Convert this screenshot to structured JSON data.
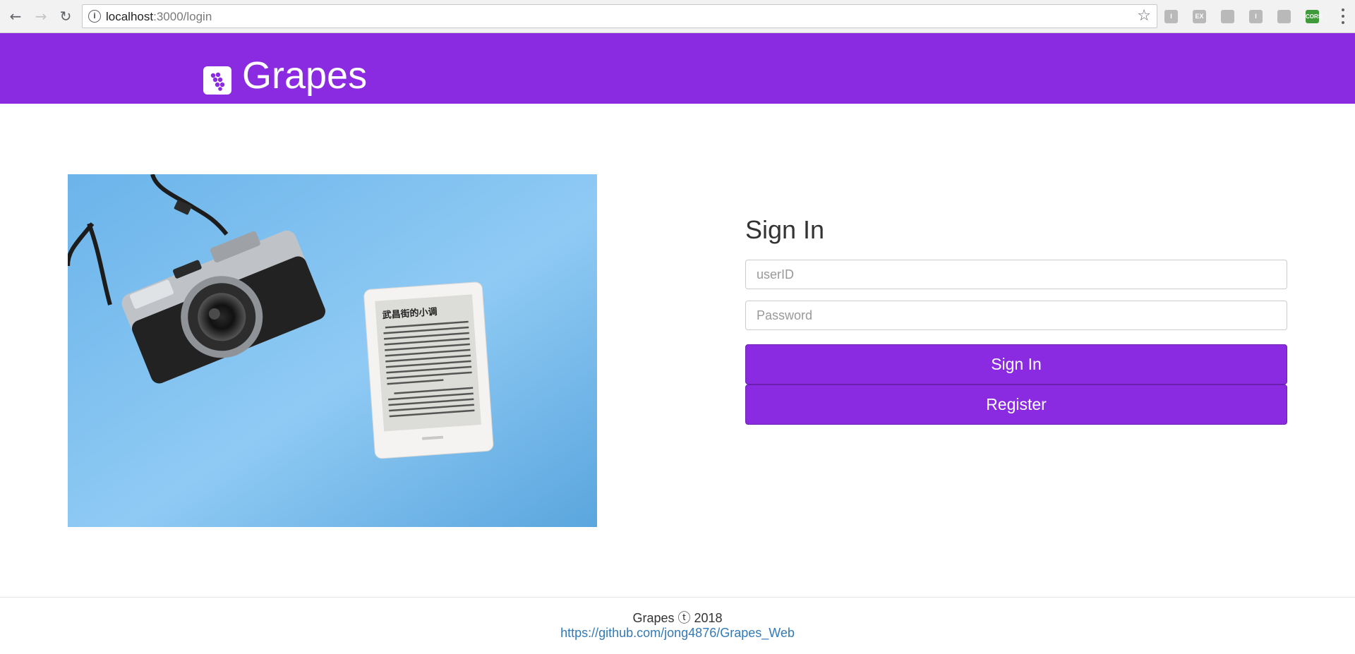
{
  "browser": {
    "url_host": "localhost",
    "url_path": ":3000/login",
    "extensions": [
      "I",
      "EX",
      "",
      "I",
      "",
      "CORS"
    ]
  },
  "header": {
    "brand": "Grapes",
    "color": "#8a2be2"
  },
  "hero": {
    "ereader_title": "武昌街的小调"
  },
  "signin": {
    "title": "Sign In",
    "userid_placeholder": "userID",
    "userid_value": "",
    "password_placeholder": "Password",
    "password_value": "",
    "signin_label": "Sign In",
    "register_label": "Register"
  },
  "footer": {
    "copyright": "Grapes ⓣ 2018",
    "link": "https://github.com/jong4876/Grapes_Web"
  },
  "icons": {
    "back": "back-arrow-icon",
    "forward": "forward-arrow-icon",
    "reload": "reload-icon",
    "info": "info-icon",
    "star": "star-icon",
    "logo": "grapes-logo-icon",
    "menu": "menu-dots-icon"
  }
}
